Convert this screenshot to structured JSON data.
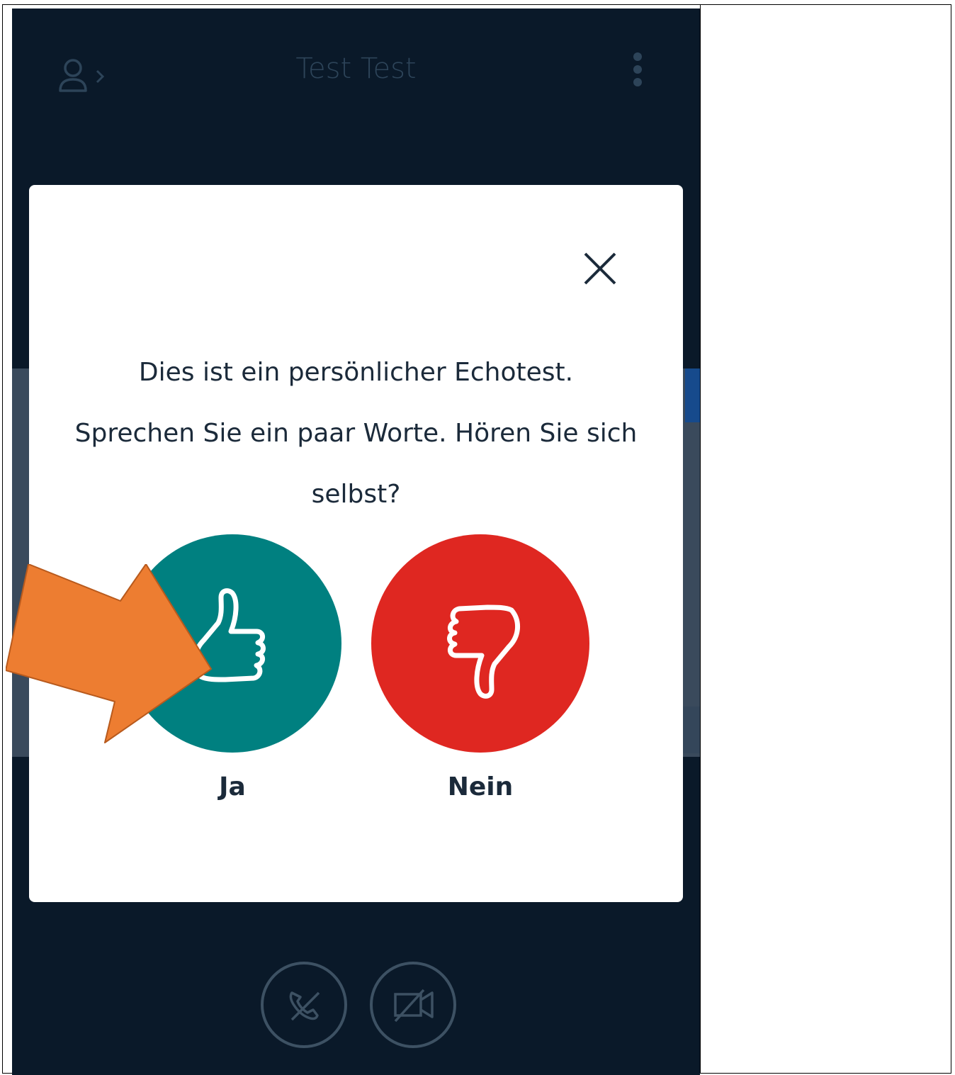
{
  "header": {
    "title": "Test Test",
    "user_icon": "user-chevron-icon",
    "menu_icon": "kebab-menu-icon"
  },
  "echo_test_modal": {
    "close_icon": "close-icon",
    "message_line1": "Dies ist ein persönlicher Echotest.",
    "message_line2": "Sprechen Sie ein paar Worte. Hören Sie sich selbst?",
    "yes": {
      "label": "Ja",
      "icon": "thumbs-up-icon",
      "color": "#008080"
    },
    "no": {
      "label": "Nein",
      "icon": "thumbs-down-icon",
      "color": "#df2721"
    }
  },
  "bottom_controls": {
    "hangup_icon": "phone-hangup-icon",
    "video_icon": "video-off-icon"
  },
  "annotation": {
    "arrow_color": "#ed7d31",
    "arrow_icon": "pointer-arrow-icon"
  },
  "colors": {
    "app_background": "#0a1929",
    "modal_background": "#ffffff"
  }
}
